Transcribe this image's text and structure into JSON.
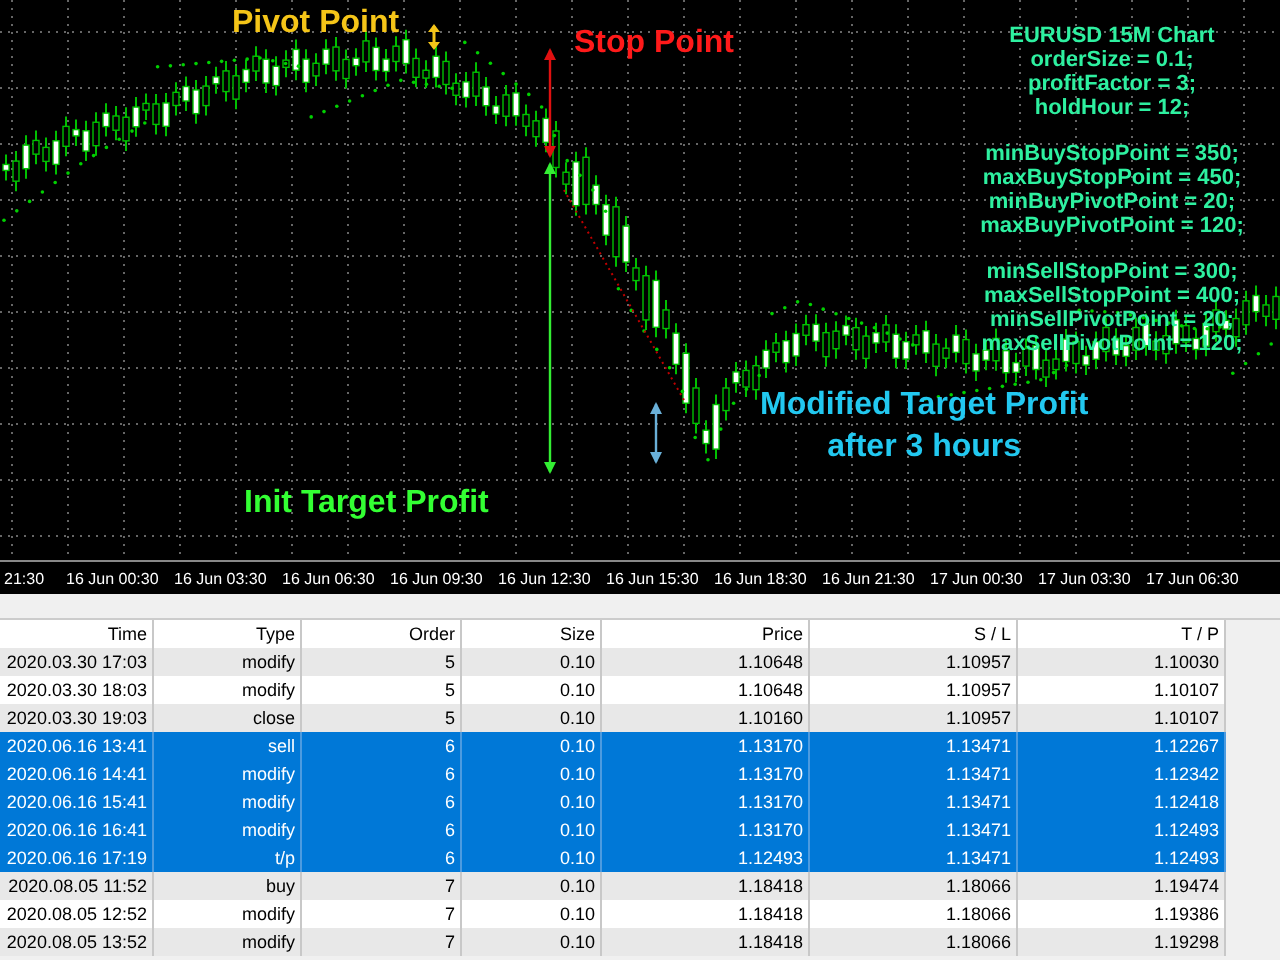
{
  "chart": {
    "labels": [
      {
        "kind": "single",
        "text": "Pivot Point",
        "color": "#f5c518"
      },
      {
        "kind": "single",
        "text": "Stop Point",
        "color": "#ff1a1a"
      },
      {
        "kind": "single",
        "text": "Init Target Profit",
        "color": "#33ff33"
      },
      {
        "kind": "multi",
        "lines": [
          "Modified Target Profit",
          "after 3 hours"
        ],
        "color": "#22c8f0"
      }
    ],
    "settings": [
      [
        "EURUSD 15M Chart",
        "orderSize = 0.1;",
        "profitFactor = 3;",
        "holdHour = 12;"
      ],
      [
        "minBuyStopPoint = 350;",
        "maxBuyStopPoint = 450;",
        "minBuyPivotPoint = 20;",
        "maxBuyPivotPoint = 120;"
      ],
      [
        "minSellStopPoint = 300;",
        "maxSellStopPoint = 400;",
        "minSellPivotPoint = 20;",
        "maxSellPivotPoint = 120;"
      ]
    ],
    "time_axis": [
      "21:30",
      "16 Jun 00:30",
      "16 Jun 03:30",
      "16 Jun 06:30",
      "16 Jun 09:30",
      "16 Jun 12:30",
      "16 Jun 15:30",
      "16 Jun 18:30",
      "16 Jun 21:30",
      "17 Jun 00:30",
      "17 Jun 03:30",
      "17 Jun 06:30"
    ]
  },
  "table": {
    "columns": [
      "Time",
      "Type",
      "Order",
      "Size",
      "Price",
      "S / L",
      "T / P"
    ],
    "rows": [
      {
        "cells": [
          "2020.03.30 17:03",
          "modify",
          "5",
          "0.10",
          "1.10648",
          "1.10957",
          "1.10030"
        ],
        "selected": false
      },
      {
        "cells": [
          "2020.03.30 18:03",
          "modify",
          "5",
          "0.10",
          "1.10648",
          "1.10957",
          "1.10107"
        ],
        "selected": false
      },
      {
        "cells": [
          "2020.03.30 19:03",
          "close",
          "5",
          "0.10",
          "1.10160",
          "1.10957",
          "1.10107"
        ],
        "selected": false
      },
      {
        "cells": [
          "2020.06.16 13:41",
          "sell",
          "6",
          "0.10",
          "1.13170",
          "1.13471",
          "1.12267"
        ],
        "selected": true
      },
      {
        "cells": [
          "2020.06.16 14:41",
          "modify",
          "6",
          "0.10",
          "1.13170",
          "1.13471",
          "1.12342"
        ],
        "selected": true
      },
      {
        "cells": [
          "2020.06.16 15:41",
          "modify",
          "6",
          "0.10",
          "1.13170",
          "1.13471",
          "1.12418"
        ],
        "selected": true
      },
      {
        "cells": [
          "2020.06.16 16:41",
          "modify",
          "6",
          "0.10",
          "1.13170",
          "1.13471",
          "1.12493"
        ],
        "selected": true
      },
      {
        "cells": [
          "2020.06.16 17:19",
          "t/p",
          "6",
          "0.10",
          "1.12493",
          "1.13471",
          "1.12493"
        ],
        "selected": true
      },
      {
        "cells": [
          "2020.08.05 11:52",
          "buy",
          "7",
          "0.10",
          "1.18418",
          "1.18066",
          "1.19474"
        ],
        "selected": false
      },
      {
        "cells": [
          "2020.08.05 12:52",
          "modify",
          "7",
          "0.10",
          "1.18418",
          "1.18066",
          "1.19386"
        ],
        "selected": false
      },
      {
        "cells": [
          "2020.08.05 13:52",
          "modify",
          "7",
          "0.10",
          "1.18418",
          "1.18066",
          "1.19298"
        ],
        "selected": false
      }
    ]
  }
}
